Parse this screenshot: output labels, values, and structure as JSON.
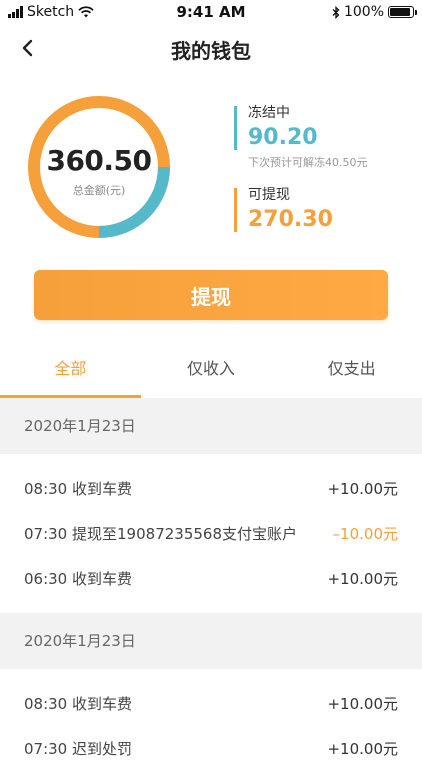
{
  "status_bar": {
    "carrier": "Sketch",
    "time": "9:41 AM",
    "battery": "100%",
    "battery_level": 1.0
  },
  "nav": {
    "title": "我的钱包"
  },
  "summary": {
    "total_amount": "360.50",
    "total_label": "总金额(元)",
    "frozen_label": "冻结中",
    "frozen_amount": "90.20",
    "frozen_hint": "下次预计可解冻40.50元",
    "available_label": "可提现",
    "available_amount": "270.30",
    "frozen_color": "#56B9C9",
    "available_color": "#F5A03A",
    "frozen_fraction": 0.25
  },
  "withdraw_button": {
    "label": "提现"
  },
  "tabs": [
    {
      "label": "全部",
      "active": true
    },
    {
      "label": "仅收入",
      "active": false
    },
    {
      "label": "仅支出",
      "active": false
    }
  ],
  "groups": [
    {
      "date": "2020年1月23日",
      "items": [
        {
          "time": "08:30",
          "desc": "收到车费",
          "amount": "+10.00元",
          "type": "income"
        },
        {
          "time": "07:30",
          "desc": "提现至19087235568支付宝账户",
          "amount": "–10.00元",
          "type": "expense"
        },
        {
          "time": "06:30",
          "desc": "收到车费",
          "amount": "+10.00元",
          "type": "income"
        }
      ]
    },
    {
      "date": "2020年1月23日",
      "items": [
        {
          "time": "08:30",
          "desc": "收到车费",
          "amount": "+10.00元",
          "type": "income"
        },
        {
          "time": "07:30",
          "desc": "迟到处罚",
          "amount": "+10.00元",
          "type": "income"
        }
      ]
    }
  ]
}
